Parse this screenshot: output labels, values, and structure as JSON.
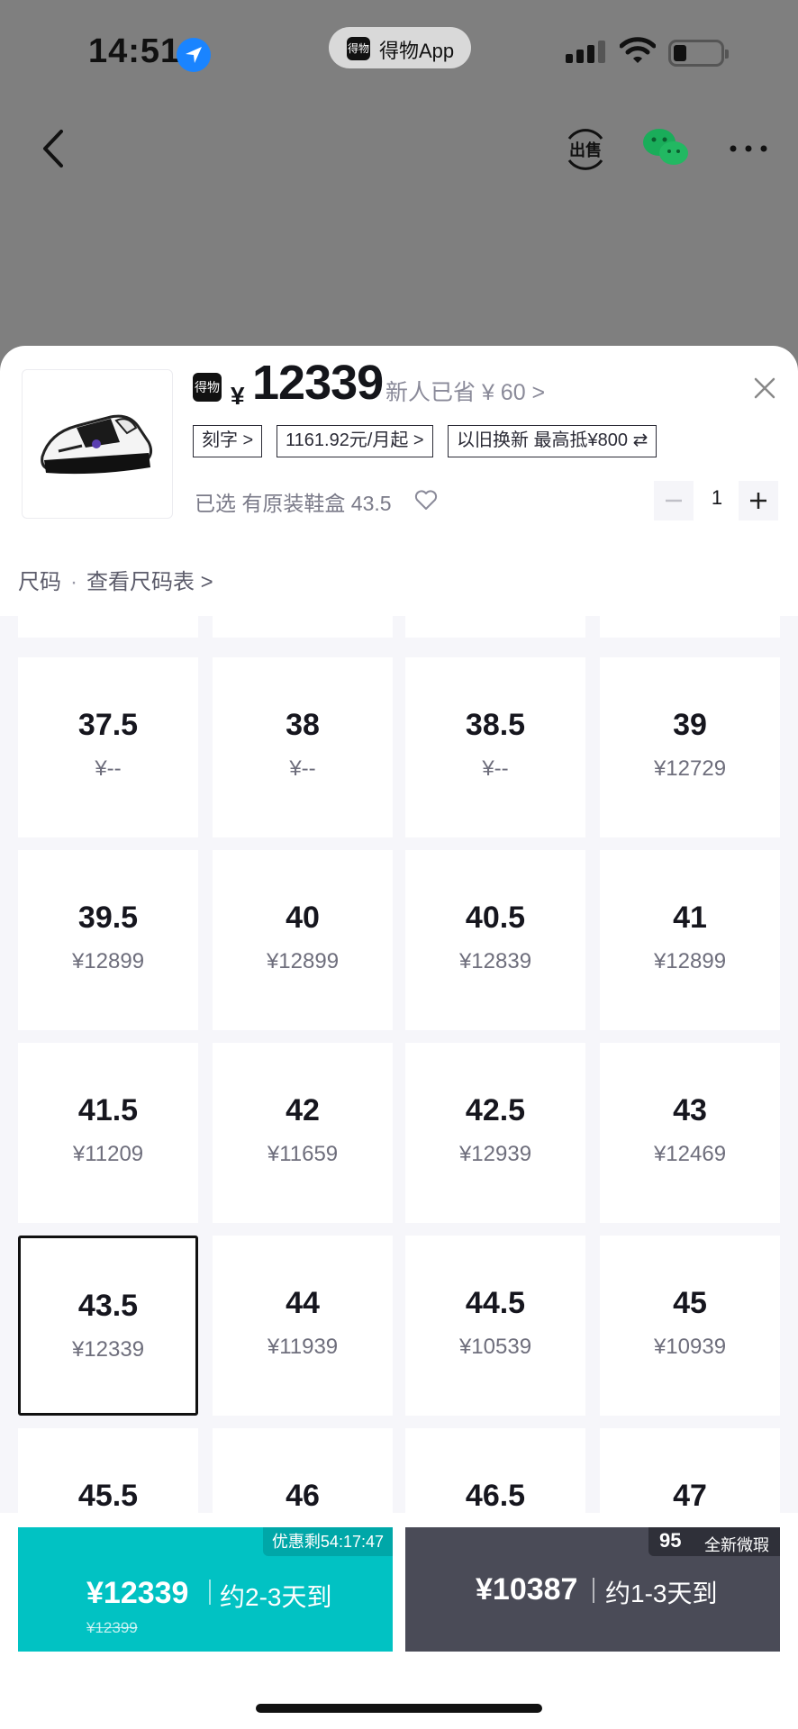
{
  "status_bar": {
    "time": "14:51",
    "app_name": "得物App",
    "app_logo_text": "得物"
  },
  "product": {
    "price_logo_text": "得物",
    "currency": "¥",
    "price": "12339",
    "new_user_saving": "新人已省 ¥ 60 >",
    "tags": [
      "刻字 >",
      "1161.92元/月起 >",
      "以旧换新 最高抵¥800 ⇄"
    ],
    "selected_text": "已选 有原装鞋盒 43.5",
    "quantity": "1"
  },
  "size_header": {
    "label": "尺码",
    "dot": "·",
    "link": "查看尺码表 >"
  },
  "sizes": [
    {
      "size": "37.5",
      "price": "¥--"
    },
    {
      "size": "38",
      "price": "¥--"
    },
    {
      "size": "38.5",
      "price": "¥--"
    },
    {
      "size": "39",
      "price": "¥12729"
    },
    {
      "size": "39.5",
      "price": "¥12899"
    },
    {
      "size": "40",
      "price": "¥12899"
    },
    {
      "size": "40.5",
      "price": "¥12839"
    },
    {
      "size": "41",
      "price": "¥12899"
    },
    {
      "size": "41.5",
      "price": "¥11209"
    },
    {
      "size": "42",
      "price": "¥11659"
    },
    {
      "size": "42.5",
      "price": "¥12939"
    },
    {
      "size": "43",
      "price": "¥12469"
    },
    {
      "size": "43.5",
      "price": "¥12339",
      "selected": true
    },
    {
      "size": "44",
      "price": "¥11939"
    },
    {
      "size": "44.5",
      "price": "¥10539"
    },
    {
      "size": "45",
      "price": "¥10939"
    },
    {
      "size": "45.5",
      "price": ""
    },
    {
      "size": "46",
      "price": ""
    },
    {
      "size": "46.5",
      "price": ""
    },
    {
      "size": "47",
      "price": ""
    }
  ],
  "buy_left": {
    "promo": "优惠剩54:17:47",
    "price": "¥12339",
    "delivery": "约2-3天到",
    "original": "¥12399"
  },
  "buy_right": {
    "badge_num": "95",
    "badge_text": "全新微瑕",
    "price": "¥10387",
    "delivery": "约1-3天到"
  },
  "colors": {
    "accent": "#01c2c3",
    "dark_button": "#4a4b57"
  }
}
